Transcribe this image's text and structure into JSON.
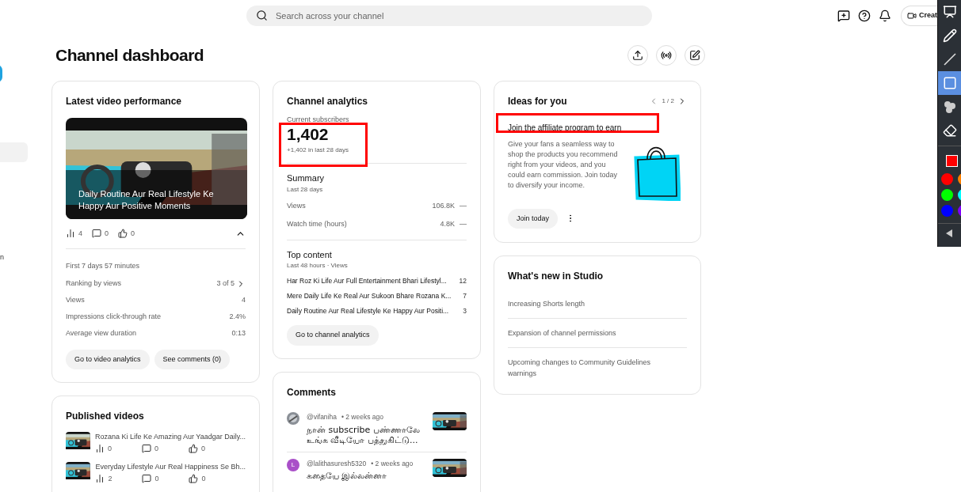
{
  "search": {
    "placeholder": "Search across your channel"
  },
  "create_button": "Creat",
  "sidebar": {
    "fragment": "n",
    "items": [
      {
        "selected": true
      }
    ]
  },
  "page_title": "Channel dashboard",
  "latest_video": {
    "title": "Latest video performance",
    "video_title": "Daily Routine Aur Real Lifestyle Ke Happy Aur Positive Moments",
    "views": "4",
    "comments": "0",
    "likes": "0",
    "expanded": true,
    "period": "First 7 days 57 minutes",
    "metrics": [
      {
        "label": "Ranking by views",
        "value": "3 of 5",
        "kind": "link"
      },
      {
        "label": "Views",
        "value": "4",
        "kind": "plain"
      },
      {
        "label": "Impressions click-through rate",
        "value": "2.4%",
        "kind": "plain"
      },
      {
        "label": "Average view duration",
        "value": "0:13",
        "kind": "plain"
      }
    ],
    "buttons": [
      "Go to video analytics",
      "See comments (0)"
    ]
  },
  "channel_analytics": {
    "title": "Channel analytics",
    "subscribers_label": "Current subscribers",
    "subscribers": "1,402",
    "change": "+1,402 in last 28 days",
    "summary": {
      "title": "Summary",
      "subtitle": "Last 28 days",
      "metrics": [
        {
          "label": "Views",
          "value": "106.8K",
          "trend": "—"
        },
        {
          "label": "Watch time (hours)",
          "value": "4.8K",
          "trend": "—"
        }
      ]
    },
    "top_content": {
      "title": "Top content",
      "subtitle": "Last 48 hours · Views",
      "items": [
        {
          "title": "Har Roz Ki Life Aur Full Entertainment Bhari Lifestyl...",
          "value": "12"
        },
        {
          "title": "Mere Daily Life Ke Real Aur Sukoon Bhare Rozana K...",
          "value": "7"
        },
        {
          "title": "Daily Routine Aur Real Lifestyle Ke Happy Aur Positi...",
          "value": "3"
        }
      ]
    },
    "button": "Go to channel analytics"
  },
  "ideas": {
    "title": "Ideas for you",
    "page": "1 / 2",
    "idea_title": "Join the affiliate program to earn",
    "description": "Give your fans a seamless way to shop the products you recommend right from your videos, and you could earn commission. Join today to diversify your income.",
    "button": "Join today"
  },
  "whats_new": {
    "title": "What's new in Studio",
    "items": [
      "Increasing Shorts length",
      "Expansion of channel permissions",
      "Upcoming changes to Community Guidelines warnings"
    ]
  },
  "published_videos": {
    "title": "Published videos",
    "items": [
      {
        "title": "Rozana Ki Life Ke Amazing Aur Yaadgar Daily...",
        "views": "0",
        "comments": "0",
        "likes": "0"
      },
      {
        "title": "Everyday Lifestyle Aur Real Happiness Se Bh...",
        "views": "2",
        "comments": "0",
        "likes": "0"
      }
    ]
  },
  "comments": {
    "title": "Comments",
    "items": [
      {
        "author": "@vifaniha",
        "time": "• 2 weeks ago",
        "text": "நான் subscribe பண்ணாலே உங்க வீடியோ பத்துகிட்டு..."
      },
      {
        "author": "@lalithasuresh5320",
        "time": "• 2 weeks ago",
        "text": "கதையே இல்லன்னா",
        "letter": "L",
        "color": "#a94fc8"
      }
    ]
  },
  "annotation_toolbar": {
    "tools": [
      {
        "kind": "board",
        "selected": false
      },
      {
        "kind": "pen",
        "selected": false
      },
      {
        "kind": "line",
        "selected": false
      },
      {
        "kind": "rectangle",
        "selected": true
      },
      {
        "kind": "numbers",
        "selected": false
      },
      {
        "kind": "eraser",
        "selected": false
      }
    ],
    "current": {
      "color": "#ff0000"
    },
    "palette": [
      {
        "color": "#ff0000"
      },
      {
        "color": "#ff8000"
      },
      {
        "color": "#00ff00"
      },
      {
        "color": "#00ffff"
      },
      {
        "color": "#0000ff"
      },
      {
        "color": "#8000ff"
      }
    ]
  }
}
